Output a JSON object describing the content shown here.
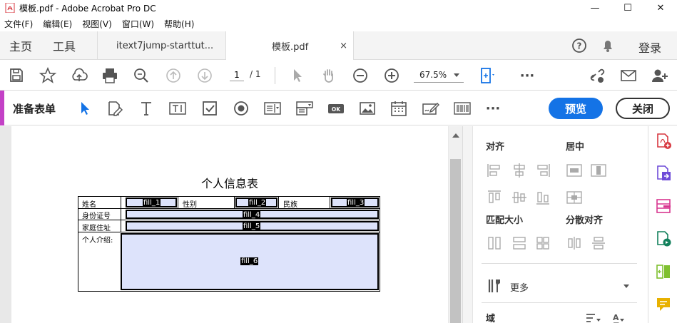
{
  "window": {
    "title": "模板.pdf - Adobe Acrobat Pro DC",
    "controls": {
      "minimize": "—",
      "maximize": "☐",
      "close": "✕"
    }
  },
  "menu": [
    "文件(F)",
    "编辑(E)",
    "视图(V)",
    "窗口(W)",
    "帮助(H)"
  ],
  "tabs": {
    "home": "主页",
    "tools": "工具",
    "doc_tabs": [
      {
        "label": "itext7jump-starttut...",
        "active": false
      },
      {
        "label": "模板.pdf",
        "active": true,
        "close": "×"
      }
    ],
    "login": "登录"
  },
  "toolbar": {
    "page_current": "1",
    "page_total": "/ 1",
    "zoom": "67.5%"
  },
  "formbar": {
    "title": "准备表单",
    "preview": "预览",
    "close": "关闭",
    "more": "···"
  },
  "document": {
    "form_title": "个人信息表",
    "labels": {
      "name": "姓名",
      "gender": "性别",
      "ethnicity": "民族",
      "id_number": "身份证号",
      "address": "家庭住址",
      "intro": "个人介绍:"
    },
    "fields": [
      "fill_1",
      "fill_2",
      "fill_3",
      "fill_4",
      "fill_5",
      "fill_6"
    ]
  },
  "right_panel": {
    "align": "对齐",
    "center": "居中",
    "match_size": "匹配大小",
    "distribute": "分散对齐",
    "more": "更多",
    "fields": "域"
  },
  "colors": {
    "accent": "#c341c6",
    "primary_button": "#1473e6",
    "field_fill": "#dde3fb",
    "rail_red": "#d7373f",
    "rail_purple": "#6e4bd8",
    "rail_pink": "#d83790",
    "rail_teal": "#12805c",
    "rail_green": "#7fc02f",
    "rail_yellow": "#e8b100"
  }
}
